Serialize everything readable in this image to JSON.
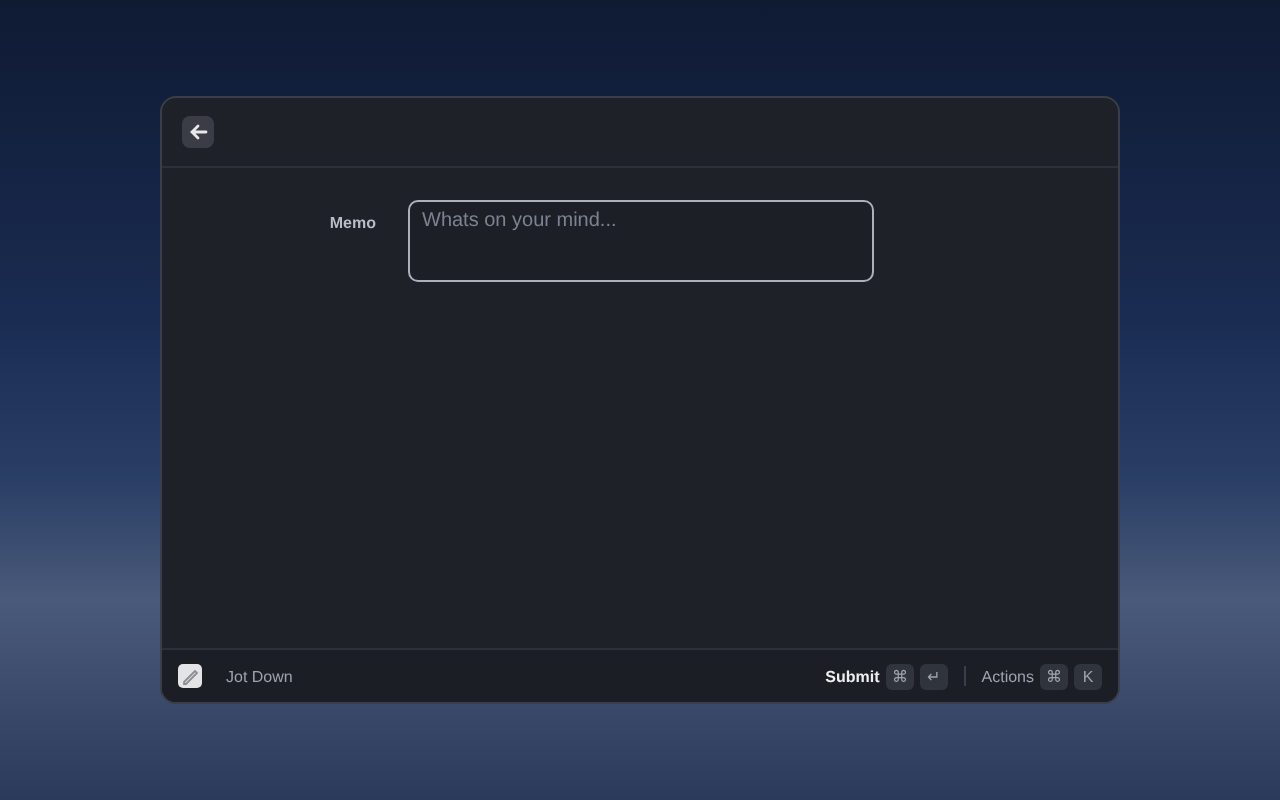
{
  "form": {
    "fields": [
      {
        "label": "Memo",
        "placeholder": "Whats on your mind..."
      }
    ]
  },
  "footer": {
    "app_name": "Jot Down",
    "primary_action": {
      "label": "Submit",
      "keys": [
        "⌘",
        "↵"
      ]
    },
    "actions": {
      "label": "Actions",
      "keys": [
        "⌘",
        "K"
      ]
    }
  }
}
